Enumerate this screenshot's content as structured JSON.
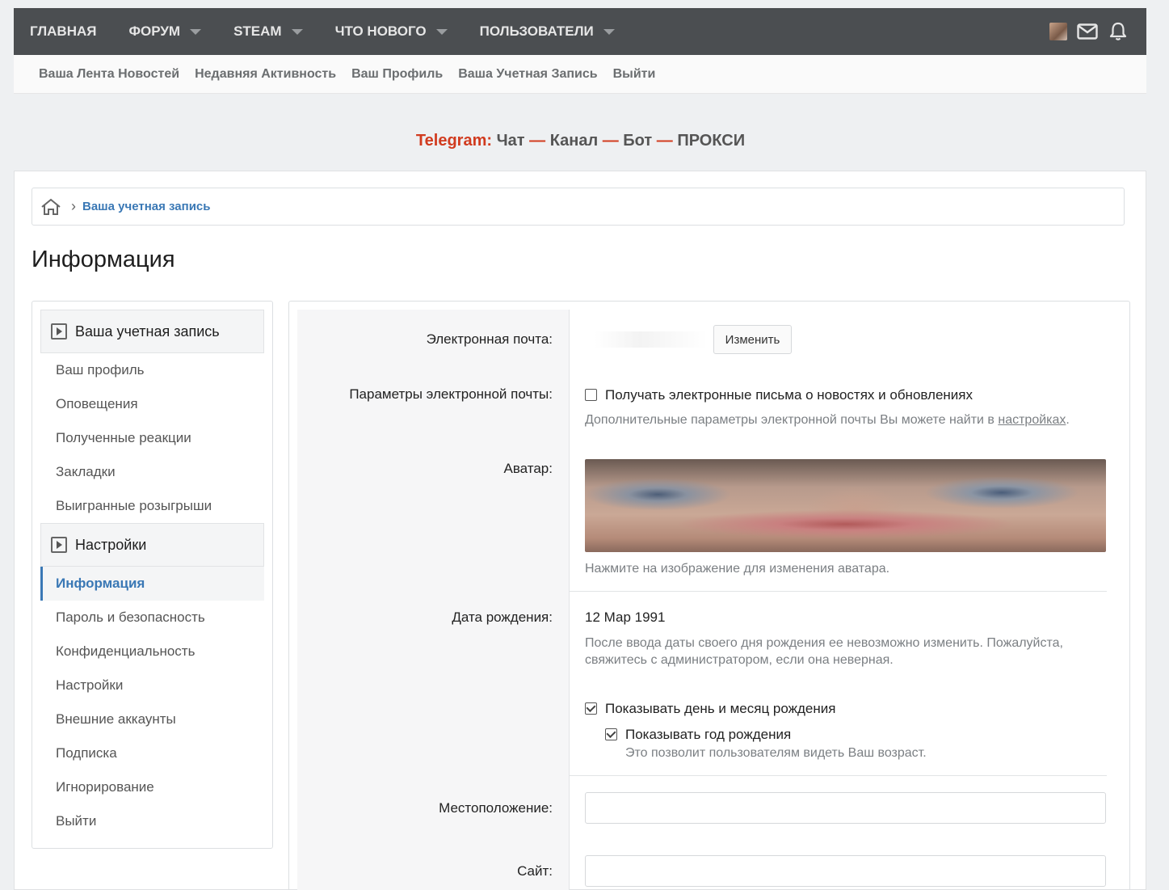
{
  "topnav": {
    "items": [
      {
        "label": "ГЛАВНАЯ",
        "caret": false
      },
      {
        "label": "ФОРУМ",
        "caret": true
      },
      {
        "label": "STEAM",
        "caret": true
      },
      {
        "label": "ЧТО НОВОГО",
        "caret": true
      },
      {
        "label": "ПОЛЬЗОВАТЕЛИ",
        "caret": true
      }
    ],
    "icons": [
      "user-avatar",
      "envelope-icon",
      "bell-icon"
    ]
  },
  "subnav": {
    "items": [
      "Ваша Лента Новостей",
      "Недавняя Активность",
      "Ваш Профиль",
      "Ваша Учетная Запись",
      "Выйти"
    ]
  },
  "telegram": {
    "prefix": "Telegram:",
    "chat": "Чат",
    "sep1": "—",
    "channel": "Канал",
    "sep2": "—",
    "bot": "Бот",
    "sep3": "—",
    "proxy": "ПРОКСИ"
  },
  "breadcrumb": {
    "link": "Ваша учетная запись"
  },
  "page": {
    "title": "Информация"
  },
  "sidebar": {
    "group1": "Ваша учетная запись",
    "group1_items": [
      "Ваш профиль",
      "Оповещения",
      "Полученные реакции",
      "Закладки",
      "Выигранные розыгрыши"
    ],
    "group2": "Настройки",
    "active": "Информация",
    "group2_items": [
      "Пароль и безопасность",
      "Конфиденциальность",
      "Настройки",
      "Внешние аккаунты",
      "Подписка",
      "Игнорирование",
      "Выйти"
    ]
  },
  "form": {
    "email_label": "Электронная почта:",
    "change_button": "Изменить",
    "email_params_label": "Параметры электронной почты:",
    "email_news_checkbox": "Получать электронные письма о новостях и обновлениях",
    "email_hint_prefix": "Дополнительные параметры электронной почты Вы можете найти в",
    "email_hint_link": "настройках",
    "email_hint_suffix": ".",
    "avatar_label": "Аватар:",
    "avatar_hint": "Нажмите на изображение для изменения аватара.",
    "dob_label": "Дата рождения:",
    "dob_value": "12 Мар 1991",
    "dob_hint_line1": "После ввода даты своего дня рождения ее невозможно изменить. Пожалуйста,",
    "dob_hint_line2": "свяжитесь с администратором, если она неверная.",
    "show_day_month": "Показывать день и месяц рождения",
    "show_year": "Показывать год рождения",
    "show_year_hint": "Это позволит пользователям видеть Ваш возраст.",
    "location_label": "Местоположение:",
    "location_value": "",
    "site_label": "Сайт:",
    "site_value": ""
  },
  "colors": {
    "topnav_bg": "#4b4e51",
    "accent": "#3a78b5",
    "telegram_red": "#d13b1f"
  }
}
